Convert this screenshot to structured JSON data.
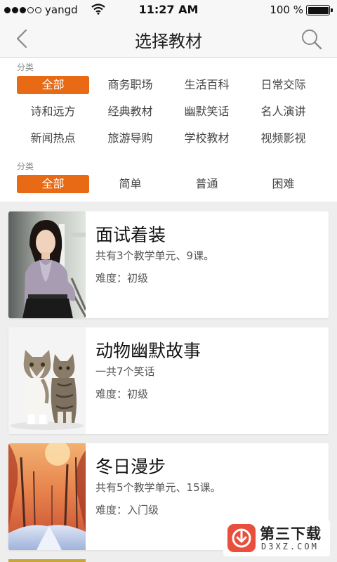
{
  "status_bar": {
    "carrier": "yangd",
    "time": "11:27 AM",
    "battery": "100 %"
  },
  "nav": {
    "title": "选择教材",
    "back_icon": "chevron-left-icon",
    "search_icon": "search-icon"
  },
  "category_filter": {
    "label": "分类",
    "options": [
      "全部",
      "商务职场",
      "生活百科",
      "日常交际",
      "诗和远方",
      "经典教材",
      "幽默笑话",
      "名人演讲",
      "新闻热点",
      "旅游导购",
      "学校教材",
      "视频影视"
    ],
    "selected": "全部"
  },
  "difficulty_filter": {
    "label": "分类",
    "options": [
      "全部",
      "简单",
      "普通",
      "困难"
    ],
    "selected": "全部"
  },
  "courses": [
    {
      "title": "面试着装",
      "description": "共有3个教学单元、9课。",
      "level": "难度：初级",
      "thumbnail": "woman-portrait-image"
    },
    {
      "title": "动物幽默故事",
      "description": "一共7个笑话",
      "level": "难度：初级",
      "thumbnail": "kittens-image"
    },
    {
      "title": "冬日漫步",
      "description": "共有5个教学单元、15课。",
      "level": "难度：入门级",
      "thumbnail": "winter-forest-image"
    }
  ],
  "watermark": {
    "title": "第三下载",
    "domain": "D3XZ.COM"
  },
  "colors": {
    "accent": "#e86a14",
    "list_background": "#eeeeee",
    "nav_background": "#f7f7f7"
  }
}
